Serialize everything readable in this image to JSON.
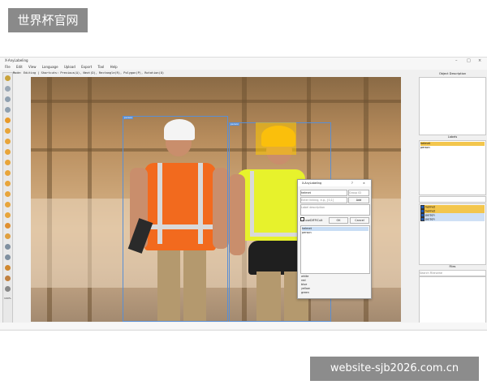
{
  "watermarks": {
    "top_left": "世界杯官网",
    "bottom_right": "website-sjb2026.com.cn"
  },
  "window": {
    "title": "X-AnyLabeling",
    "controls": [
      "–",
      "□",
      "×"
    ]
  },
  "menu": [
    "File",
    "Edit",
    "View",
    "Language",
    "Upload",
    "Export",
    "Tool",
    "Help"
  ],
  "mode_bar": "Mode: Editing | Shortcuts: Previous(A), Next(D), Rectangle(R), Polygon(P), Rotation(O)",
  "toolbar": {
    "items": [
      {
        "icon": "open-icon",
        "color": "#c9a23a"
      },
      {
        "icon": "open-dir-icon",
        "color": "#9aa7b5"
      },
      {
        "icon": "next-image-icon",
        "color": "#8fa0b0"
      },
      {
        "icon": "prev-image-icon",
        "color": "#8fa0b0"
      },
      {
        "icon": "save-icon",
        "color": "#e89a2a"
      },
      {
        "icon": "polygon-icon",
        "color": "#e8a53a"
      },
      {
        "icon": "rectangle-icon",
        "color": "#e8a53a"
      },
      {
        "icon": "rotation-icon",
        "color": "#e8a53a"
      },
      {
        "icon": "circle-icon",
        "color": "#e8a53a"
      },
      {
        "icon": "line-icon",
        "color": "#e8a53a"
      },
      {
        "icon": "point-icon",
        "color": "#e8a53a"
      },
      {
        "icon": "linestrip-icon",
        "color": "#e8a53a"
      },
      {
        "icon": "edit-icon",
        "color": "#e8a53a"
      },
      {
        "icon": "duplicate-icon",
        "color": "#e8a53a"
      },
      {
        "icon": "delete-icon",
        "color": "#e09030"
      },
      {
        "icon": "undo-icon",
        "color": "#e0a040"
      },
      {
        "icon": "zoom-in-icon",
        "color": "#8090a0"
      },
      {
        "icon": "zoom-out-icon",
        "color": "#8090a0"
      },
      {
        "icon": "fit-window-icon",
        "color": "#d08830"
      },
      {
        "icon": "brightness-icon",
        "color": "#c08040"
      },
      {
        "icon": "ai-icon",
        "color": "#888888"
      }
    ],
    "zoom_label": "100%"
  },
  "canvas": {
    "boxes": [
      {
        "label": "person",
        "name": "person-1-box"
      },
      {
        "label": "person",
        "name": "person-2-box"
      },
      {
        "label": "helmet",
        "name": "helmet-box"
      }
    ]
  },
  "dialog": {
    "title": "X-AnyLabeling",
    "help": "?",
    "close": "×",
    "label_value": "helmet",
    "group_id_placeholder": "Group ID",
    "score_placeholder": "Enter linking, e.g., [0,1]",
    "add_label": "Add",
    "description_placeholder": "Label description",
    "difficult_label": "useDIFFICult",
    "ok_label": "OK",
    "cancel_label": "Cancel",
    "list_top": [
      "helmet",
      "person"
    ],
    "list_bottom": [
      "white",
      "red",
      "blue",
      "yellow",
      "green"
    ]
  },
  "right": {
    "object_description_title": "Object Description",
    "labels_title": "Labels",
    "labels_list": [
      "helmet",
      "person"
    ],
    "label_filter": "",
    "shapes_list": [
      {
        "label": "helmet",
        "color": "#f3c64d",
        "checked": true
      },
      {
        "label": "helmet",
        "color": "#f3c64d",
        "checked": true
      },
      {
        "label": "person",
        "color": "#7aa7e0",
        "checked": true
      },
      {
        "label": "person",
        "color": "#7aa7e0",
        "checked": true
      }
    ],
    "files_title": "Files",
    "search_placeholder": "Search Filename"
  }
}
